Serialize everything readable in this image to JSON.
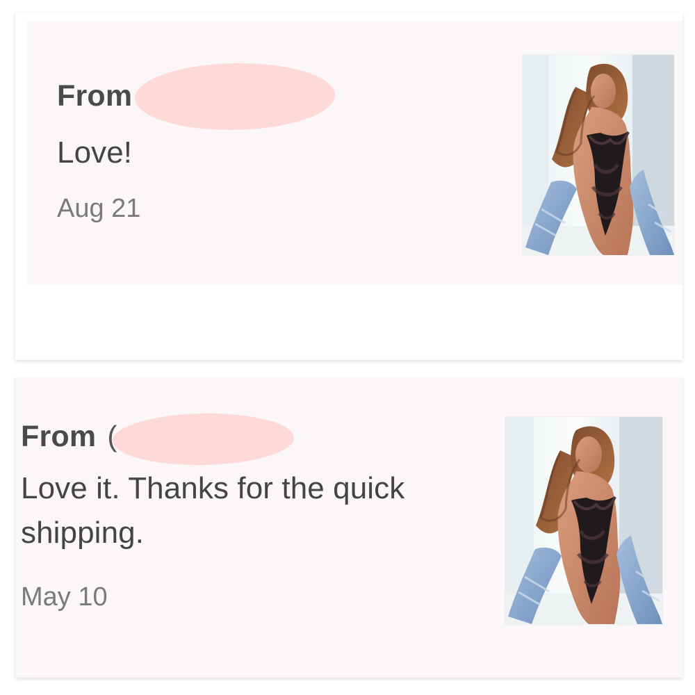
{
  "reviews": [
    {
      "from_label": "From",
      "text": "Love!",
      "date": "Aug 21",
      "thumbnail_icon": "lace-bodysuit-product-photo"
    },
    {
      "from_label": "From",
      "open_paren": "(",
      "text": "Love it. Thanks for the quick shipping.",
      "date": "May 10",
      "thumbnail_icon": "lace-bodysuit-product-photo"
    }
  ],
  "colors": {
    "redaction": "#fddad7",
    "card_background": "#fbf7f8",
    "text_dark": "#444444",
    "text_muted": "#7a7a7a"
  }
}
